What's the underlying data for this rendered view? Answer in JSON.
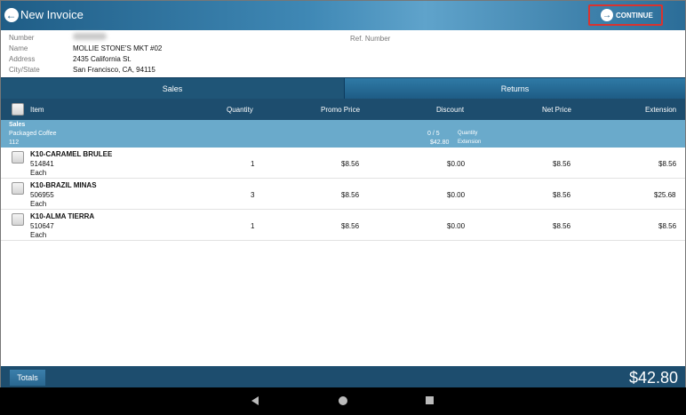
{
  "header": {
    "title": "New Invoice",
    "continue_label": "CONTINUE",
    "back_icon": "arrow-left-circle-icon",
    "continue_icon": "arrow-right-circle-icon"
  },
  "info": {
    "number_label": "Number",
    "name_label": "Name",
    "name_value": "MOLLIE STONE'S MKT #02",
    "address_label": "Address",
    "address_value": "2435 California St.",
    "city_label": "City/State",
    "city_value": "San Francisco, CA, 94115",
    "ref_label": "Ref. Number"
  },
  "tabs": [
    "Sales",
    "Returns"
  ],
  "columns": {
    "item": "Item",
    "quantity": "Quantity",
    "promo": "Promo Price",
    "discount": "Discount",
    "net": "Net Price",
    "extension": "Extension"
  },
  "group": {
    "title": "Sales",
    "category": "Packaged Coffee",
    "code": "112",
    "qty_value": "0 / 5",
    "qty_label": "Quantity",
    "ext_value": "$42.80",
    "ext_label": "Extension"
  },
  "items": [
    {
      "name": "K10-CARAMEL BRULEE",
      "sku": "514841",
      "uom": "Each",
      "qty": "1",
      "promo": "$8.56",
      "discount": "$0.00",
      "net": "$8.56",
      "ext": "$8.56"
    },
    {
      "name": "K10-BRAZIL MINAS",
      "sku": "506955",
      "uom": "Each",
      "qty": "3",
      "promo": "$8.56",
      "discount": "$0.00",
      "net": "$8.56",
      "ext": "$25.68"
    },
    {
      "name": "K10-ALMA TIERRA",
      "sku": "510647",
      "uom": "Each",
      "qty": "1",
      "promo": "$8.56",
      "discount": "$0.00",
      "net": "$8.56",
      "ext": "$8.56"
    }
  ],
  "totals": {
    "label": "Totals",
    "value": "$42.80"
  },
  "colors": {
    "header_blue": "#1f5d86",
    "table_header": "#1d4d6e",
    "group_row": "#6aaacb",
    "highlight_red": "#d9332f"
  }
}
